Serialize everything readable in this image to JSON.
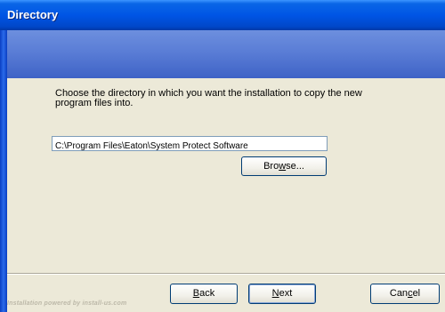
{
  "window": {
    "title": "Directory"
  },
  "body": {
    "instruction": "Choose the directory in which you want the installation to copy the new program files into.",
    "path_value": "C:\\Program Files\\Eaton\\System Protect Software",
    "browse_label_pre": "Bro",
    "browse_label_ul": "w",
    "browse_label_post": "se..."
  },
  "footer": {
    "powered_by": "Installation powered by install-us.com",
    "back_ul": "B",
    "back_rest": "ack",
    "next_ul": "N",
    "next_rest": "ext",
    "cancel_pre": "Can",
    "cancel_ul": "c",
    "cancel_post": "el"
  }
}
